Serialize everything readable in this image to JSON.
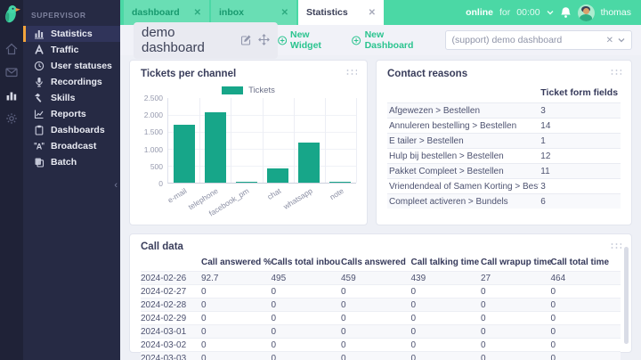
{
  "app": {
    "section_label": "SUPERVISOR"
  },
  "colors": {
    "topbar_green": "#4bd8a5",
    "accent_green": "#2bc48f",
    "bar_green": "#17a689",
    "active_orange": "#f2a43c",
    "sidebar_bg": "#262a44"
  },
  "sidebar": {
    "items": [
      {
        "label": "Statistics",
        "active": true
      },
      {
        "label": "Traffic",
        "active": false
      },
      {
        "label": "User statuses",
        "active": false
      },
      {
        "label": "Recordings",
        "active": false
      },
      {
        "label": "Skills",
        "active": false
      },
      {
        "label": "Reports",
        "active": false
      },
      {
        "label": "Dashboards",
        "active": false
      },
      {
        "label": "Broadcast",
        "active": false
      },
      {
        "label": "Batch",
        "active": false
      }
    ]
  },
  "topbar": {
    "tabs": [
      {
        "label": "dashboard",
        "active": false
      },
      {
        "label": "inbox",
        "active": false
      },
      {
        "label": "Statistics",
        "active": true
      }
    ],
    "presence": {
      "state": "online",
      "separator": "for",
      "duration": "00:00"
    },
    "username": "thomas"
  },
  "header": {
    "title": "demo dashboard",
    "actions": {
      "new_widget": "New Widget",
      "new_dashboard": "New Dashboard"
    },
    "dashboard_select": {
      "value": "(support) demo dashboard"
    }
  },
  "chart_data": {
    "type": "bar",
    "title": "Tickets per channel",
    "legend": [
      "Tickets"
    ],
    "legend_position": "top",
    "categories": [
      "e-mail",
      "telephone",
      "facebook_pm",
      "chat",
      "whatsapp",
      "note"
    ],
    "values": [
      1700,
      2080,
      30,
      430,
      1190,
      10
    ],
    "ylim": [
      0,
      2500
    ],
    "yticks": [
      "2.500",
      "2.000",
      "1.500",
      "1.000",
      "500",
      "0"
    ],
    "grid": true,
    "bar_color": "#17a689"
  },
  "widgets": {
    "tickets": {
      "title": "Tickets per channel"
    },
    "contact_reasons": {
      "title": "Contact reasons",
      "value_header": "Ticket form fields",
      "rows": [
        {
          "label": "Afgewezen > Bestellen",
          "value": "3"
        },
        {
          "label": "Annuleren bestelling > Bestellen",
          "value": "14"
        },
        {
          "label": "E tailer > Bestellen",
          "value": "1"
        },
        {
          "label": "Hulp bij bestellen > Bestellen",
          "value": "12"
        },
        {
          "label": "Pakket Compleet > Bestellen",
          "value": "11"
        },
        {
          "label": "Vriendendeal of Samen Korting > Bestellen",
          "value": "3"
        },
        {
          "label": "Compleet activeren > Bundels",
          "value": "6"
        }
      ]
    },
    "call_data": {
      "title": "Call data",
      "columns": [
        "Call answered %",
        "Calls total inbound",
        "Calls answered",
        "Call talking time",
        "Call wrapup time",
        "Call total time"
      ],
      "rows": [
        {
          "date": "2024-02-26",
          "values": [
            "92.7",
            "495",
            "459",
            "439",
            "27",
            "464"
          ]
        },
        {
          "date": "2024-02-27",
          "values": [
            "0",
            "0",
            "0",
            "0",
            "0",
            "0"
          ]
        },
        {
          "date": "2024-02-28",
          "values": [
            "0",
            "0",
            "0",
            "0",
            "0",
            "0"
          ]
        },
        {
          "date": "2024-02-29",
          "values": [
            "0",
            "0",
            "0",
            "0",
            "0",
            "0"
          ]
        },
        {
          "date": "2024-03-01",
          "values": [
            "0",
            "0",
            "0",
            "0",
            "0",
            "0"
          ]
        },
        {
          "date": "2024-03-02",
          "values": [
            "0",
            "0",
            "0",
            "0",
            "0",
            "0"
          ]
        },
        {
          "date": "2024-03-03",
          "values": [
            "0",
            "0",
            "0",
            "0",
            "0",
            "0"
          ]
        }
      ]
    }
  }
}
